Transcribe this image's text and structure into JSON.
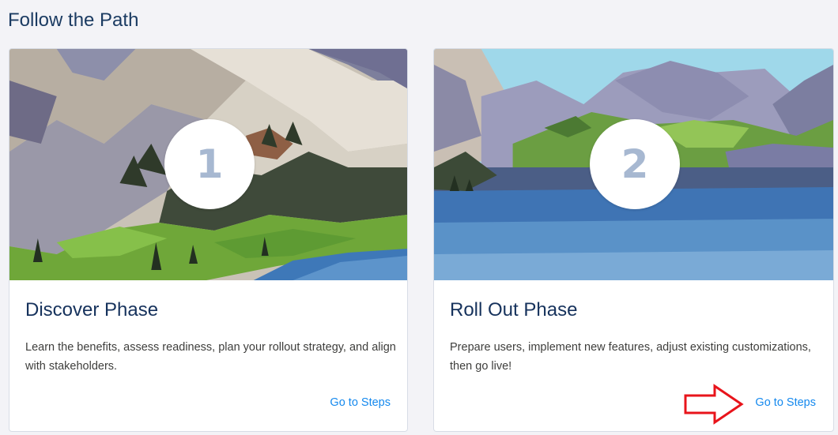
{
  "section": {
    "title": "Follow the Path"
  },
  "cards": [
    {
      "number": "1",
      "title": "Discover Phase",
      "description": "Learn the benefits, assess readiness, plan your rollout strategy, and align with stakeholders.",
      "link_label": "Go to Steps"
    },
    {
      "number": "2",
      "title": "Roll Out Phase",
      "description": "Prepare users, implement new features, adjust existing customizations, then go live!",
      "link_label": "Go to Steps"
    }
  ],
  "colors": {
    "page_background": "#f3f3f7",
    "heading": "#16325c",
    "link": "#1589ee",
    "badge_number": "#a7b8d1",
    "annotation_arrow": "#e8141b"
  }
}
